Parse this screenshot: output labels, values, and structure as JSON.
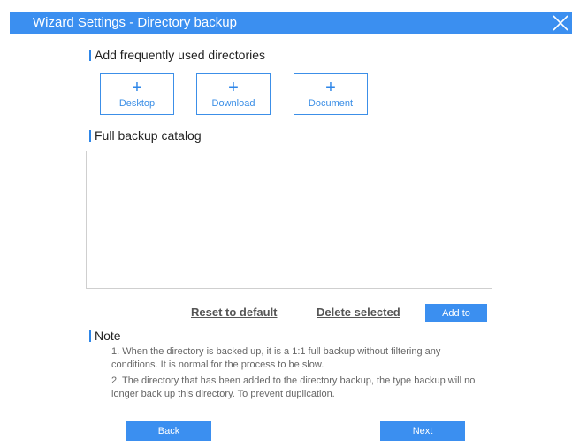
{
  "window": {
    "title": "Wizard Settings - Directory backup",
    "close_icon": "close-icon"
  },
  "frequent": {
    "heading": "Add frequently used directories",
    "items": [
      {
        "label": "Desktop",
        "icon": "+"
      },
      {
        "label": "Download",
        "icon": "+"
      },
      {
        "label": "Document",
        "icon": "+"
      }
    ]
  },
  "catalog": {
    "heading": "Full backup catalog",
    "entries": []
  },
  "actions": {
    "reset_label": "Reset to default",
    "delete_label": "Delete selected",
    "add_label": "Add to"
  },
  "note": {
    "heading": "Note",
    "lines": [
      "1. When the directory is backed up, it is a 1:1 full backup without filtering any conditions. It is normal for the process to be slow.",
      "2. The directory that has been added to the directory backup, the type backup will no longer back up this directory. To prevent duplication."
    ]
  },
  "footer": {
    "back_label": "Back",
    "next_label": "Next"
  },
  "colors": {
    "accent": "#3b8ff0",
    "heading_bar": "#2e86e8",
    "border": "#cfcfcf"
  }
}
